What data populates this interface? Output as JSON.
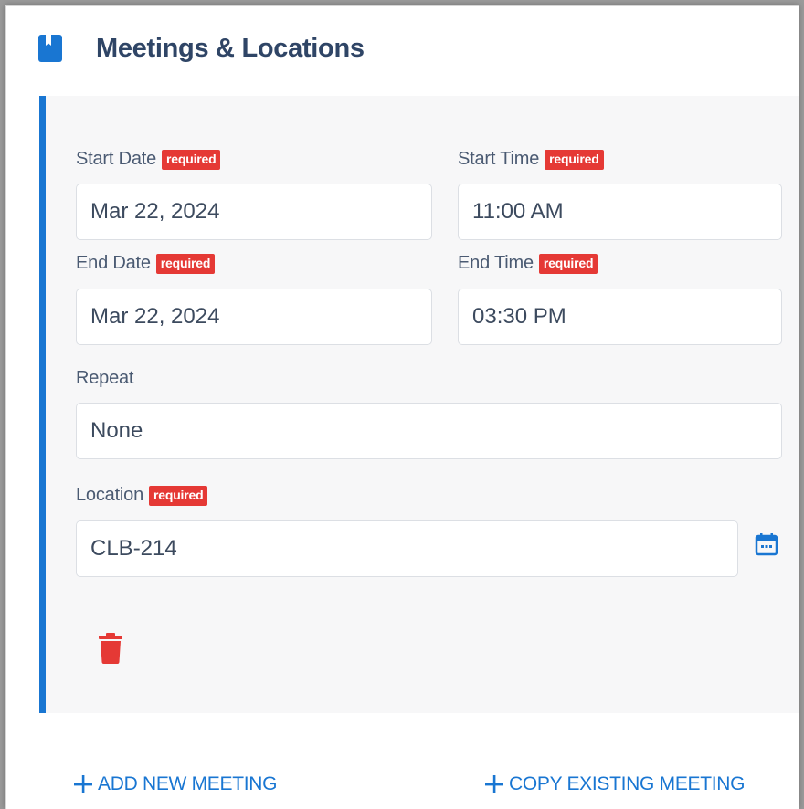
{
  "section": {
    "title": "Meetings & Locations",
    "icon": "bookmark-book-icon"
  },
  "meeting": {
    "required_badge": "required",
    "start_date": {
      "label": "Start Date",
      "value": "Mar 22, 2024"
    },
    "start_time": {
      "label": "Start Time",
      "value": "11:00 AM"
    },
    "end_date": {
      "label": "End Date",
      "value": "Mar 22, 2024"
    },
    "end_time": {
      "label": "End Time",
      "value": "03:30 PM"
    },
    "repeat": {
      "label": "Repeat",
      "value": "None"
    },
    "location": {
      "label": "Location",
      "value": "CLB-214",
      "picker_icon": "calendar-icon"
    },
    "delete_icon": "trash-icon"
  },
  "actions": {
    "add_new_meeting": "ADD NEW MEETING",
    "copy_existing_meeting": "COPY EXISTING MEETING"
  },
  "colors": {
    "accent": "#1976d2",
    "required_badge": "#e53935",
    "title": "#2f4566",
    "delete": "#e53935"
  }
}
